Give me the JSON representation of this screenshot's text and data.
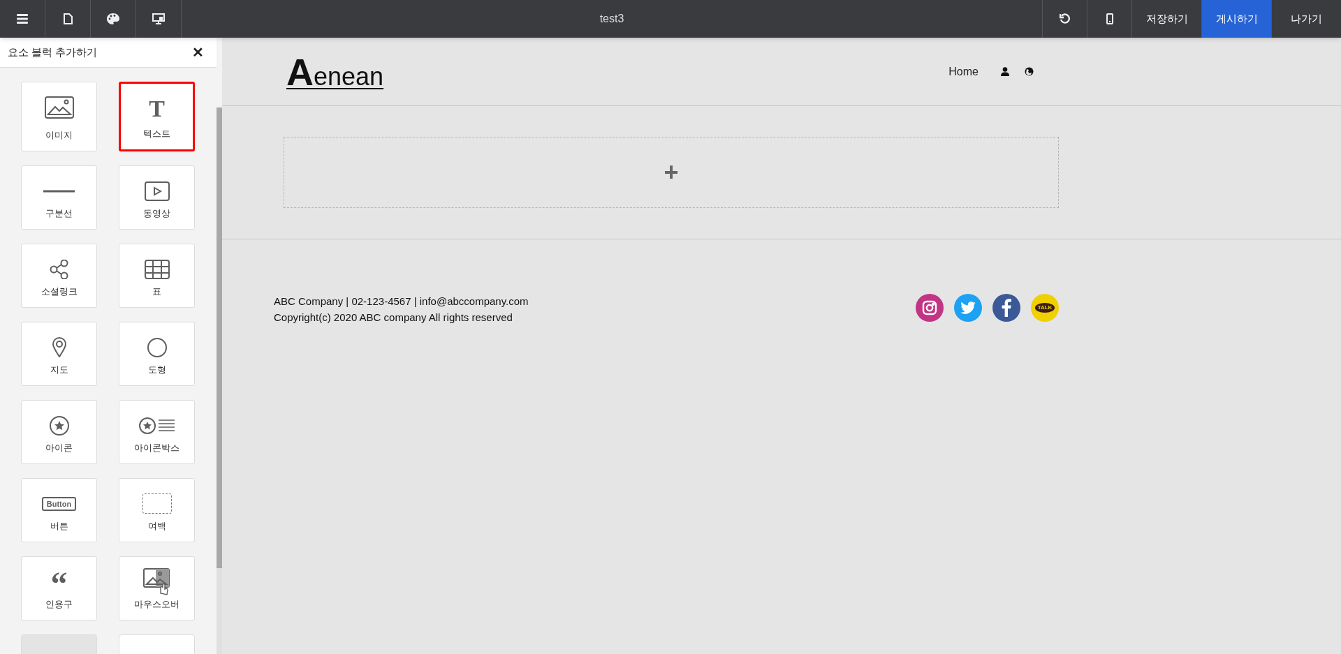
{
  "toolbar": {
    "left_buttons": [
      {
        "kind": "menu"
      },
      {
        "kind": "page"
      },
      {
        "kind": "palette"
      },
      {
        "kind": "desktop"
      }
    ],
    "title": "test3",
    "right_buttons": [
      {
        "kind": "undo"
      },
      {
        "kind": "mobile"
      },
      {
        "kind": "text",
        "label": "저장하기",
        "selected": false
      },
      {
        "kind": "text",
        "label": "게시하기",
        "selected": true
      },
      {
        "kind": "text",
        "label": "나가기",
        "selected": false
      }
    ]
  },
  "panel": {
    "title": "요소 블럭 추가하기",
    "close": "✕",
    "blocks": [
      {
        "kind": "image",
        "label": "이미지",
        "selected": false
      },
      {
        "kind": "text",
        "label": "텍스트",
        "icon_text": "T",
        "selected": true
      },
      {
        "kind": "divider",
        "label": "구분선",
        "selected": false
      },
      {
        "kind": "video",
        "label": "동영상",
        "selected": false
      },
      {
        "kind": "social",
        "label": "소셜링크",
        "selected": false
      },
      {
        "kind": "table",
        "label": "표",
        "selected": false
      },
      {
        "kind": "map",
        "label": "지도",
        "selected": false
      },
      {
        "kind": "shape",
        "label": "도형",
        "selected": false
      },
      {
        "kind": "icon",
        "label": "아이콘",
        "selected": false
      },
      {
        "kind": "iconbox",
        "label": "아이콘박스",
        "selected": false
      },
      {
        "kind": "button",
        "label": "버튼",
        "icon_text": "Button",
        "selected": false
      },
      {
        "kind": "spacer",
        "label": "여백",
        "selected": false
      },
      {
        "kind": "quote",
        "label": "인용구",
        "icon_text": "“",
        "selected": false
      },
      {
        "kind": "hover",
        "label": "마우스오버",
        "selected": false
      },
      {
        "kind": "partial",
        "disabled": true,
        "selected": false
      },
      {
        "kind": "partial",
        "disabled": false,
        "selected": false
      }
    ]
  },
  "site": {
    "logo_initial": "A",
    "logo_rest": "enean",
    "nav": [
      {
        "kind": "link",
        "label": "Home"
      },
      {
        "kind": "user"
      },
      {
        "kind": "globe"
      }
    ],
    "add_block": "+",
    "footer": {
      "lines": [
        "ABC Company | 02-123-4567 | info@abccompany.com",
        "Copyright(c) 2020 ABC company All rights reserved"
      ],
      "social": [
        {
          "kind": "instagram",
          "color": "#c13584"
        },
        {
          "kind": "twitter",
          "color": "#1da1f2"
        },
        {
          "kind": "facebook",
          "color": "#3b5998"
        },
        {
          "kind": "kakao",
          "color": "#f0d000",
          "text": "TALK"
        }
      ]
    }
  }
}
